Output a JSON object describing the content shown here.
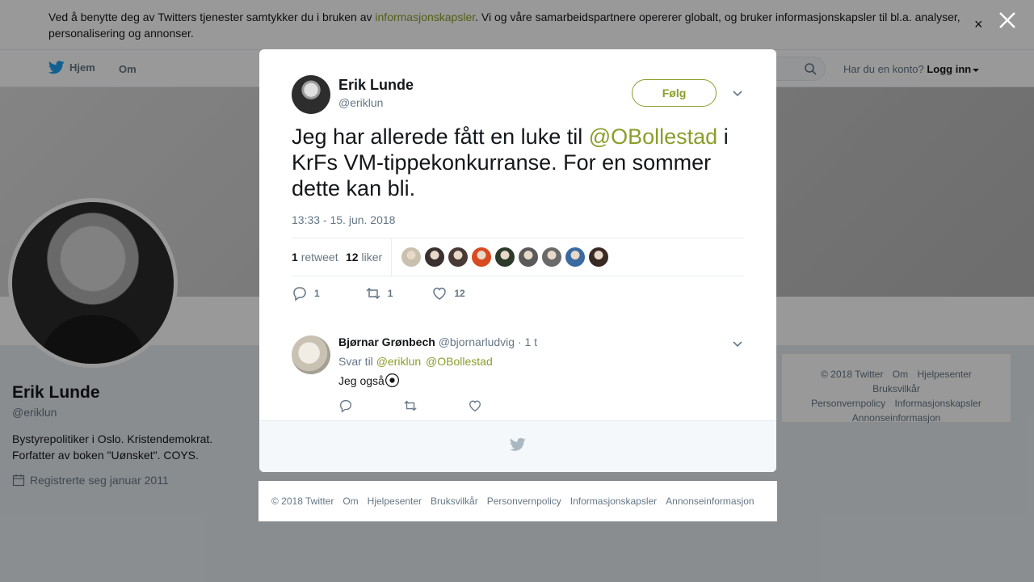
{
  "cookie": {
    "text_before": "Ved å benytte deg av Twitters tjenester samtykker du i bruken av ",
    "link": "informasjonskapsler",
    "text_after": ". Vi og våre samarbeidspartnere opererer globalt, og bruker informasjonskapsler til bl.a. analyser, personalisering og annonser.",
    "close": "×"
  },
  "nav": {
    "home": "Hjem",
    "about": "Om",
    "login_prompt": "Har du en konto?",
    "login": "Logg inn"
  },
  "profile": {
    "name": "Erik Lunde",
    "handle": "@eriklun",
    "bio_line1": "Bystyrepolitiker i Oslo. Kristendemokrat.",
    "bio_line2": "Forfatter av boken \"Uønsket\". COYS.",
    "joined": "Registrerte seg januar 2011"
  },
  "side_footer": [
    "© 2018 Twitter",
    "Om",
    "Hjelpesenter",
    "Bruksvilkår",
    "Personvernpolicy",
    "Informasjonskapsler",
    "Annonseinformasjon"
  ],
  "tweet": {
    "author_name": "Erik Lunde",
    "author_handle": "@eriklun",
    "follow_label": "Følg",
    "text_before": "Jeg har allerede fått en luke til ",
    "mention": "@OBollestad",
    "text_after": " i KrFs VM-tippekonkurranse. For en sommer dette kan bli.",
    "timestamp": "13:33 - 15. jun. 2018",
    "retweet_count": "1",
    "retweet_label": "retweet",
    "like_count": "12",
    "like_label": "liker",
    "action_reply_count": "1",
    "action_retweet_count": "1",
    "action_like_count": "12"
  },
  "likers": [
    "#c9c0ae",
    "#3a3030",
    "#4a3a35",
    "#d84a20",
    "#2d3a2a",
    "#5a5a5a",
    "#6a6a6a",
    "#3a6aa0",
    "#3a2a25"
  ],
  "reply": {
    "name": "Bjørnar Grønbech",
    "handle": "@bjornarludvig",
    "time": "· 1 t",
    "reply_to_label": "Svar til",
    "reply_to_1": "@eriklun",
    "reply_to_2": "@OBollestad",
    "text": "Jeg også"
  },
  "footer": [
    "© 2018 Twitter",
    "Om",
    "Hjelpesenter",
    "Bruksvilkår",
    "Personvernpolicy",
    "Informasjonskapsler",
    "Annonseinformasjon"
  ],
  "colors": {
    "accent": "#8a9e2c",
    "muted": "#657786",
    "text": "#14171a"
  }
}
